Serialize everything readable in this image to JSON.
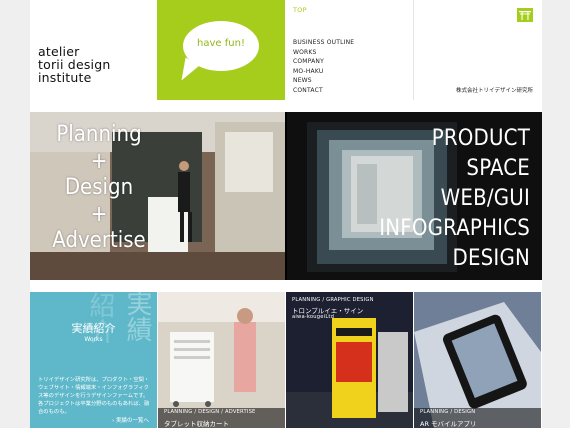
{
  "brand": {
    "lines": [
      "atelier",
      "torii design",
      "institute"
    ]
  },
  "speech": {
    "text": "have fun!"
  },
  "nav": {
    "top": "TOP",
    "items": [
      "BUSINESS OUTLINE",
      "WORKS",
      "COMPANY",
      "MO-HAKU",
      "NEWS",
      "CONTACT"
    ]
  },
  "corp": {
    "logo_icon": "torii-gate-icon",
    "name": "株式会社トリイデザイン研究所"
  },
  "hero": {
    "left_lines": [
      "Planning",
      "+",
      "Design",
      "+",
      "Advertise"
    ],
    "right_lines": [
      "PRODUCT",
      "SPACE",
      "WEB/GUI",
      "INFOGRAPHICS",
      "DESIGN"
    ]
  },
  "works": {
    "kanji_a": "紹介",
    "kanji_b": "実績",
    "title": "実績紹介",
    "sub": "Works",
    "desc": "トリイデザイン研究所は、プロダクト・空間・ウェブサイト・情報端末・インフォグラフィクス等のデザインを行うデザインファームです。各プロジェクトは卒業分野のものもあれば、融合のものも。",
    "more": "› 実績の一覧へ"
  },
  "tiles": [
    {
      "category": "PLANNING / DESIGN / ADVERTISE",
      "title": "タブレット収納カート"
    },
    {
      "category": "PLANNING / GRAPHIC DESIGN",
      "title": "トロンプルイエ・サイン",
      "sub": "aiwa-kougeiLtd"
    },
    {
      "category": "PLANNING / DESIGN",
      "title": "AR モバイルアプリ"
    }
  ],
  "colors": {
    "accent": "#a6cd1c",
    "works_bg": "#5fb8c9"
  }
}
